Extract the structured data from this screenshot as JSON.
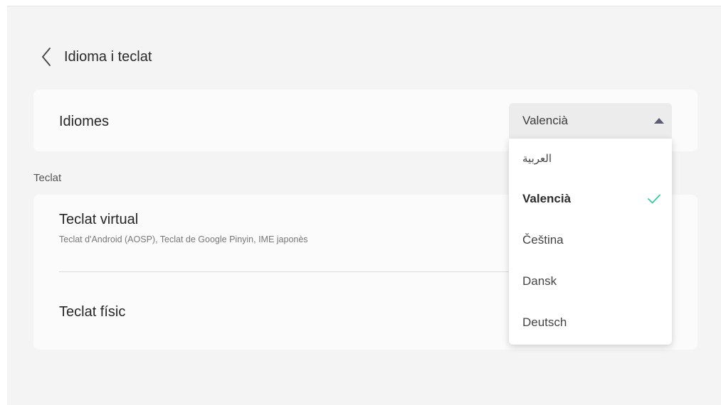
{
  "header": {
    "title": "Idioma i teclat"
  },
  "language": {
    "label": "Idiomes",
    "selected": "Valencià",
    "options": [
      {
        "label": "العربية",
        "selected": false
      },
      {
        "label": "Valencià",
        "selected": true
      },
      {
        "label": "Čeština",
        "selected": false
      },
      {
        "label": "Dansk",
        "selected": false
      },
      {
        "label": "Deutsch",
        "selected": false
      }
    ]
  },
  "keyboard": {
    "section_label": "Teclat",
    "virtual": {
      "label": "Teclat virtual",
      "summary": "Teclat d'Android (AOSP), Teclat de Google Pinyin, IME japonès"
    },
    "physical": {
      "label": "Teclat físic"
    }
  },
  "colors": {
    "accent_check": "#3cc8a0",
    "caret": "#5c5c72"
  },
  "icons": {
    "back": "chevron-left-icon",
    "caret": "caret-up-icon",
    "check": "check-icon"
  }
}
